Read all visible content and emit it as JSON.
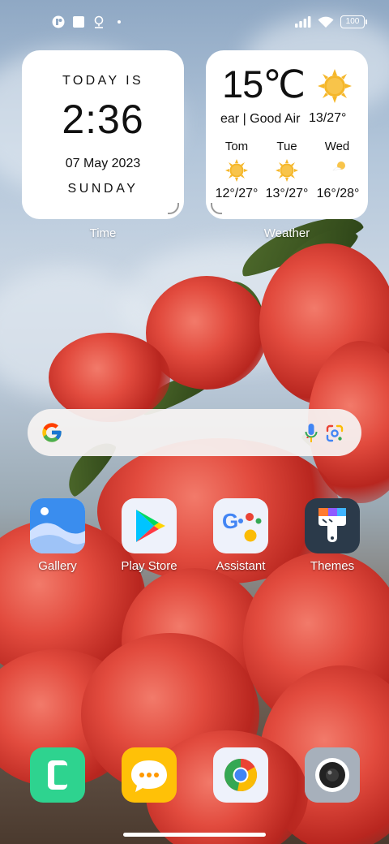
{
  "status_bar": {
    "left_icons": [
      "app-notification-icon",
      "square-notification-icon",
      "location-notification-icon"
    ],
    "right_icons": [
      "signal-icon",
      "wifi-icon"
    ],
    "battery_level": "100"
  },
  "clock_widget": {
    "label": "TODAY IS",
    "time": "2:36",
    "date": "07 May 2023",
    "day": "SUNDAY",
    "caption": "Time"
  },
  "weather_widget": {
    "temperature": "15℃",
    "condition": "ear | Good Air",
    "range": "13/27°",
    "current_icon": "sun-icon",
    "forecast": [
      {
        "day": "Tom",
        "icon": "sun-icon",
        "temps": "12°/27°"
      },
      {
        "day": "Tue",
        "icon": "sun-icon",
        "temps": "13°/27°"
      },
      {
        "day": "Wed",
        "icon": "sun-cloud-icon",
        "temps": "16°/28°"
      }
    ],
    "caption": "Weather"
  },
  "search_bar": {
    "logo": "google-g-icon",
    "icons": [
      "microphone-icon",
      "camera-lens-icon"
    ]
  },
  "apps": [
    {
      "label": "Gallery",
      "icon": "gallery-icon"
    },
    {
      "label": "Play Store",
      "icon": "play-store-icon"
    },
    {
      "label": "Assistant",
      "icon": "assistant-icon"
    },
    {
      "label": "Themes",
      "icon": "themes-brush-icon"
    }
  ],
  "dock": [
    {
      "icon": "phone-icon"
    },
    {
      "icon": "messages-icon"
    },
    {
      "icon": "chrome-icon"
    },
    {
      "icon": "camera-icon"
    }
  ],
  "colors": {
    "phone": "#2ed38f",
    "messages": "#ffc107",
    "themes_bg": "#2b3a4a",
    "gallery_blue": "#3a8dee"
  }
}
